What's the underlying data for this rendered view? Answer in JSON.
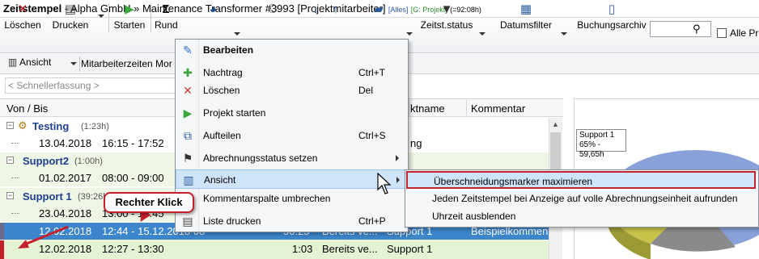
{
  "window": {
    "title_main": "Zeitstempel",
    "title_rest": " - Alpha GmbH » Maintenance Transformer #3993  [Projektmitarbeiter]",
    "filter_all": "[Alles]",
    "filter_group": "[G: Projekt]",
    "sum": "(=92:08h)"
  },
  "toolbar": {
    "delete_label": "Löschen",
    "print_label": "Drucken",
    "start_label": "Starten",
    "round_label": "Rund",
    "status_label": "Zeitst.status",
    "datefilter_label": "Datumsfilter",
    "archive_label": "Buchungsarchiv",
    "all_projects_label": "Alle Pro",
    "search_value": ""
  },
  "viewbar": {
    "view_label": "Ansicht",
    "employee_times_label": "Mitarbeiterzeiten Mor"
  },
  "quick_entry": {
    "placeholder": "< Schnellerfassung >"
  },
  "table": {
    "columns": [
      "Von / Bis",
      "ktname",
      "Kommentar"
    ],
    "rows": [
      {
        "type": "group",
        "title": "Testing",
        "duration": "(1:23h)"
      },
      {
        "type": "entry",
        "date": "13.04.2018",
        "time": "16:15 - 17:52",
        "project": "ng"
      },
      {
        "type": "group",
        "title": "Support2",
        "duration": "(1:00h)"
      },
      {
        "type": "entry",
        "date": "01.02.2017",
        "time": "08:00 - 09:00"
      },
      {
        "type": "group",
        "title": "Support 1",
        "duration": "(39:26h)"
      },
      {
        "type": "entry",
        "date": "23.04.2018",
        "time": "13:00 - 16:45"
      },
      {
        "type": "entry-selected",
        "date": "12.02.2018",
        "time": "12:44 - 15.12.2018 08",
        "hours": "50:25",
        "status": "Bereits ve...",
        "project": "Support 1",
        "comment": "Beispielkommen"
      },
      {
        "type": "entry-green",
        "date": "12.02.2018",
        "time": "12:27 - 13:30",
        "hours": "1:03",
        "status": "Bereits ve...",
        "project": "Support 1"
      }
    ]
  },
  "chart": {
    "label_name": "Support 1",
    "label_value": "65% - 59,65h"
  },
  "context_menu": {
    "items": [
      {
        "label": "Bearbeiten",
        "shortcut": ""
      },
      {
        "label": "Nachtrag",
        "shortcut": "Ctrl+T"
      },
      {
        "label": "Löschen",
        "shortcut": "Del"
      },
      {
        "label": "Projekt starten",
        "shortcut": ""
      },
      {
        "label": "Aufteilen",
        "shortcut": "Ctrl+S"
      },
      {
        "label": "Abrechnungsstatus setzen",
        "shortcut": ""
      },
      {
        "label": "Ansicht",
        "shortcut": ""
      },
      {
        "label": "Kommentarspalte umbrechen",
        "shortcut": ""
      },
      {
        "label": "Liste drucken",
        "shortcut": "Ctrl+P"
      }
    ]
  },
  "submenu": {
    "items": [
      {
        "label": "Überschneidungsmarker maximieren"
      },
      {
        "label": "Jeden Zeitstempel bei Anzeige auf volle Abrechnungseinheit aufrunden"
      },
      {
        "label": "Uhrzeit ausblenden"
      }
    ]
  },
  "callout": {
    "text": "Rechter Klick"
  },
  "colors": {
    "group_title": "#1f3f8f",
    "selected_row": "#3d86cc",
    "green_row": "#e4f3d3",
    "highlight_border": "#c3232f",
    "menu_highlight": "#cfe4fa"
  }
}
